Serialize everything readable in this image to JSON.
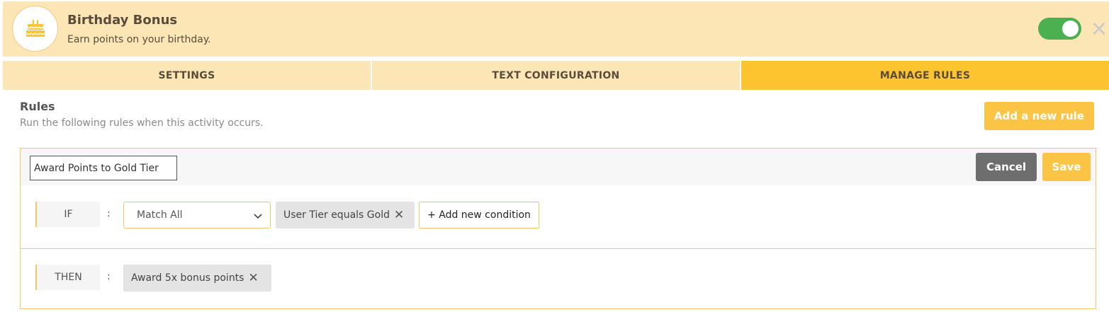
{
  "header": {
    "title": "Birthday Bonus",
    "subtitle": "Earn points on your birthday.",
    "icon": "birthday-cake-icon",
    "toggle_on": true,
    "close_icon": "close-icon"
  },
  "tabs": [
    {
      "label": "SETTINGS",
      "active": false
    },
    {
      "label": "TEXT CONFIGURATION",
      "active": false
    },
    {
      "label": "MANAGE RULES",
      "active": true
    }
  ],
  "rules": {
    "title": "Rules",
    "subtitle": "Run the following rules when this activity occurs.",
    "add_label": "Add a new rule"
  },
  "rule": {
    "name_value": "Award Points to Gold Tier",
    "cancel_label": "Cancel",
    "save_label": "Save",
    "if_label": "IF",
    "then_label": "THEN",
    "colon": ":",
    "match_select": "Match All",
    "conditions": [
      {
        "label": "User Tier equals Gold"
      }
    ],
    "add_condition_label": "+ Add new condition",
    "actions": [
      {
        "label": "Award 5x bonus points"
      }
    ]
  },
  "colors": {
    "header_bg": "#fde6b6",
    "active_tab": "#fcc42f",
    "accent_button": "#fcc445",
    "toggle_on": "#4caf50",
    "cancel_button": "#6e6e6e"
  }
}
